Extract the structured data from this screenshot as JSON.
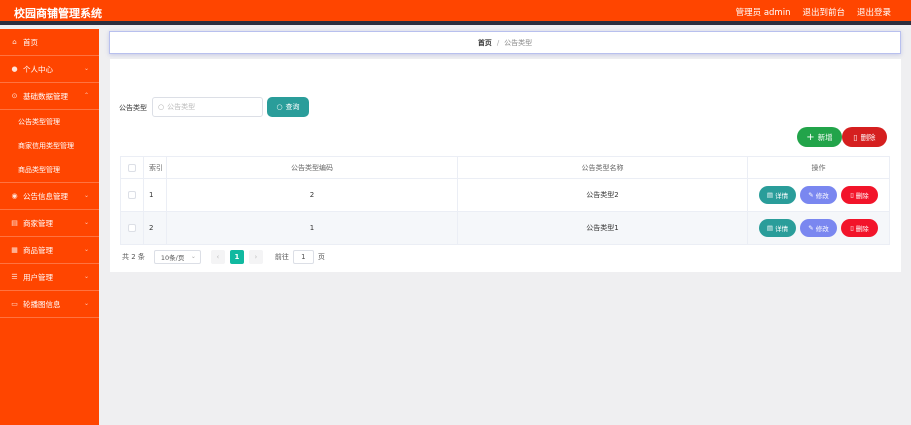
{
  "app": {
    "title": "校园商铺管理系统",
    "user_label": "管理员 admin",
    "front_link": "退出到前台",
    "logout": "退出登录"
  },
  "sidebar": {
    "items": [
      {
        "label": "首页",
        "icon": "home-icon"
      },
      {
        "label": "个人中心",
        "icon": "user-icon"
      },
      {
        "label": "基础数据管理",
        "icon": "data-icon"
      },
      {
        "label": "公告信息管理",
        "icon": "notice-icon"
      },
      {
        "label": "商家管理",
        "icon": "shop-icon"
      },
      {
        "label": "商品管理",
        "icon": "goods-icon"
      },
      {
        "label": "用户管理",
        "icon": "users-icon"
      },
      {
        "label": "轮播图信息",
        "icon": "image-icon"
      }
    ],
    "sub_items": [
      "公告类型管理",
      "商家信用类型管理",
      "商品类型管理"
    ]
  },
  "breadcrumb": {
    "home": "首页",
    "current": "公告类型"
  },
  "search": {
    "label": "公告类型",
    "placeholder": "公告类型",
    "button": "查询"
  },
  "actions": {
    "add": "新增",
    "delete": "删除"
  },
  "table": {
    "headers": {
      "index": "索引",
      "code": "公告类型编码",
      "name": "公告类型名称",
      "ops": "操作"
    },
    "rows": [
      {
        "index": "1",
        "code": "2",
        "name": "公告类型2"
      },
      {
        "index": "2",
        "code": "1",
        "name": "公告类型1"
      }
    ],
    "ops": {
      "detail": "详情",
      "edit": "修改",
      "remove": "删除"
    }
  },
  "pagination": {
    "total": "共 2 条",
    "page_size": "10条/页",
    "current_page": "1",
    "goto_label": "前往",
    "goto_value": "1",
    "page_unit": "页"
  },
  "colors": {
    "brand": "#ff4500",
    "teal": "#2a9d9a",
    "green": "#22a44a",
    "red": "#d51f1f",
    "purple": "#7a87f0",
    "bright_red": "#f2142a"
  }
}
